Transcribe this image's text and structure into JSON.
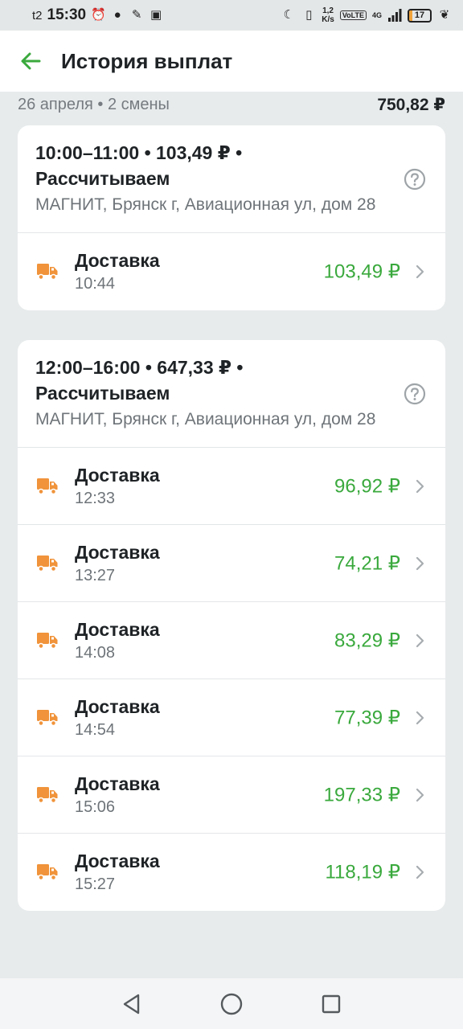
{
  "status_bar": {
    "carrier": "t2",
    "time": "15:30",
    "net_speed_value": "1,2",
    "net_speed_unit": "K/s",
    "volte": "VoLTE",
    "network": "4G",
    "battery": "17"
  },
  "header": {
    "title": "История выплат"
  },
  "day": {
    "label": "26 апреля • 2 смены",
    "total": "750,82 ₽"
  },
  "shifts": [
    {
      "title_line1": "10:00–11:00 • 103,49 ₽ •",
      "title_line2": "Рассчитываем",
      "address": "МАГНИТ, Брянск г, Авиационная ул, дом 28",
      "items": [
        {
          "title": "Доставка",
          "time": "10:44",
          "amount": "103,49 ₽"
        }
      ]
    },
    {
      "title_line1": "12:00–16:00 • 647,33 ₽ •",
      "title_line2": "Рассчитываем",
      "address": "МАГНИТ, Брянск г, Авиационная ул, дом 28",
      "items": [
        {
          "title": "Доставка",
          "time": "12:33",
          "amount": "96,92 ₽"
        },
        {
          "title": "Доставка",
          "time": "13:27",
          "amount": "74,21 ₽"
        },
        {
          "title": "Доставка",
          "time": "14:08",
          "amount": "83,29 ₽"
        },
        {
          "title": "Доставка",
          "time": "14:54",
          "amount": "77,39 ₽"
        },
        {
          "title": "Доставка",
          "time": "15:06",
          "amount": "197,33 ₽"
        },
        {
          "title": "Доставка",
          "time": "15:27",
          "amount": "118,19 ₽"
        }
      ]
    }
  ],
  "colors": {
    "accent_green": "#3aa93d",
    "truck_orange": "#f0933a",
    "background": "#e8ebec"
  },
  "icons": {
    "back": "arrow-left-icon",
    "help": "question-circle-icon",
    "item": "truck-icon",
    "chevron": "chevron-right-icon"
  }
}
